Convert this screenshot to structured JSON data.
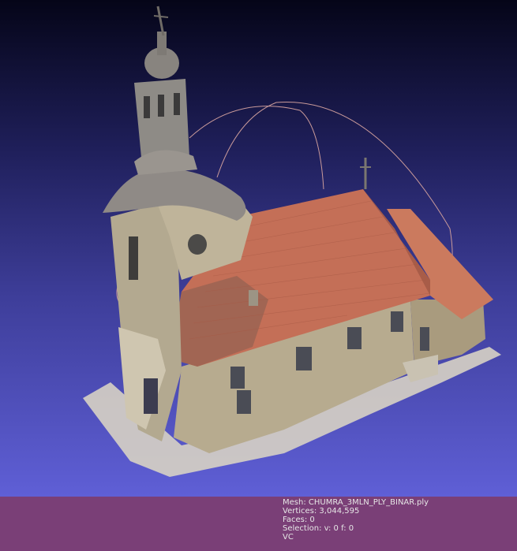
{
  "info": {
    "mesh": "Mesh: CHUMRA_3MLN_PLY_BINAR.ply",
    "vertices": "Vertices: 3,044,595",
    "faces": "Faces: 0",
    "selection": "Selection: v: 0 f: 0",
    "color_mode": "VC"
  },
  "colors": {
    "background_top": "#050518",
    "background_bottom": "#5f5fd6",
    "infobar": "#7a3f77",
    "roof": "#c8735a",
    "wall": "#b9ad92",
    "trackball": "#c99a9a"
  },
  "icons": {
    "model": "point-cloud-church",
    "trackball": "trackball-arc"
  }
}
